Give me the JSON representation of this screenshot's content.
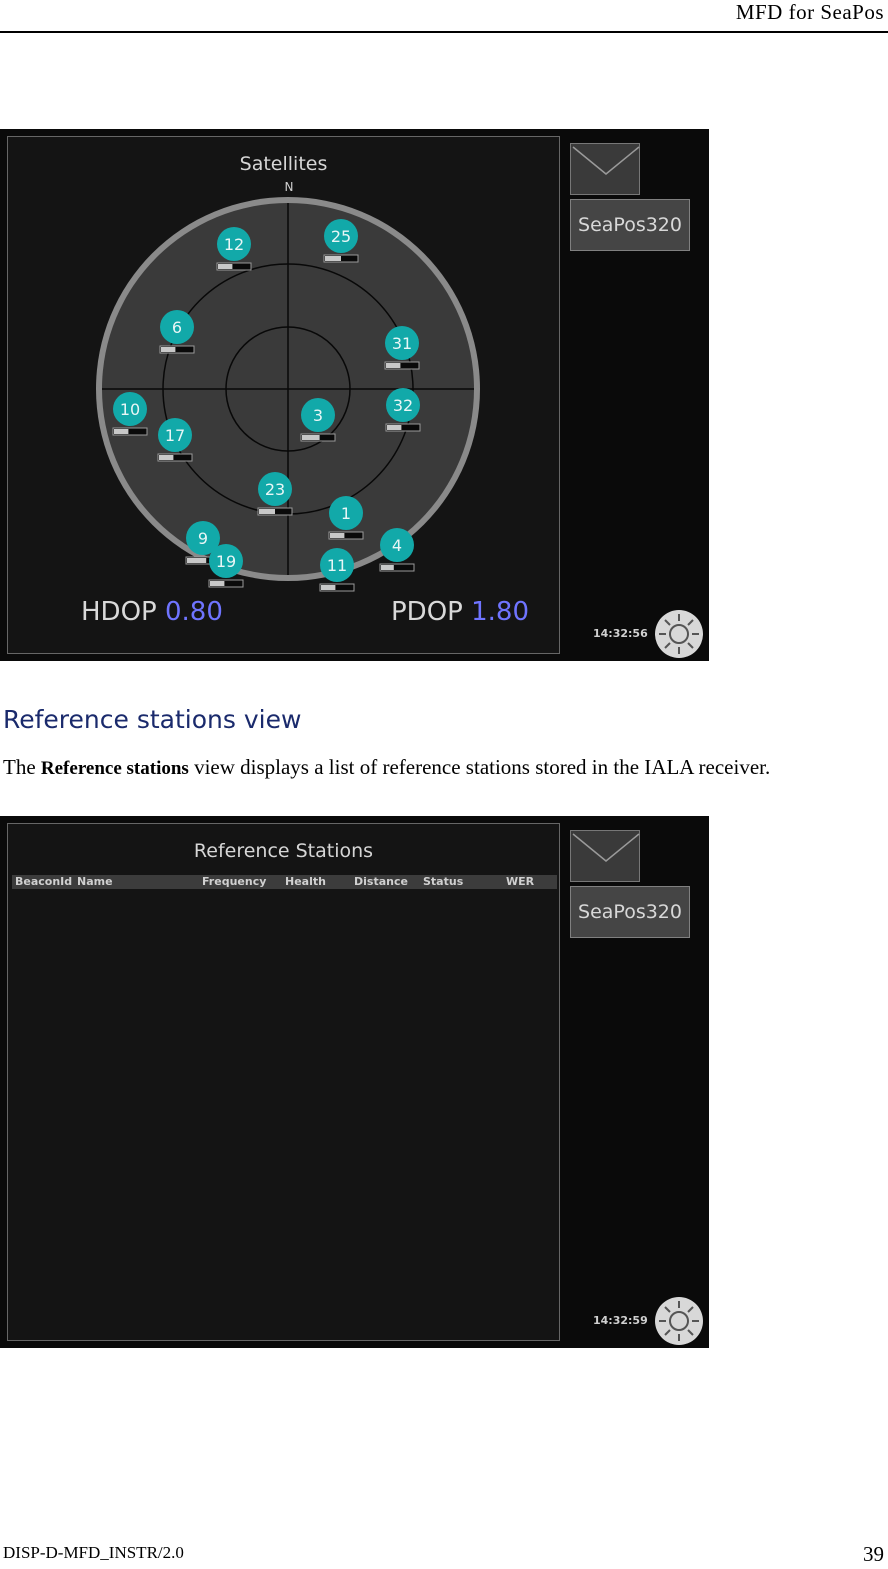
{
  "header": {
    "title": "MFD  for  SeaPos"
  },
  "satellites_screen": {
    "title": "Satellites",
    "north_label": "N",
    "satellites": [
      {
        "id": "12",
        "signal": 0.45
      },
      {
        "id": "25",
        "signal": 0.5
      },
      {
        "id": "6",
        "signal": 0.45
      },
      {
        "id": "31",
        "signal": 0.45
      },
      {
        "id": "10",
        "signal": 0.45
      },
      {
        "id": "17",
        "signal": 0.45
      },
      {
        "id": "3",
        "signal": 0.55
      },
      {
        "id": "32",
        "signal": 0.45
      },
      {
        "id": "23",
        "signal": 0.5
      },
      {
        "id": "1",
        "signal": 0.45
      },
      {
        "id": "4",
        "signal": 0.4
      },
      {
        "id": "9",
        "signal": 0.6
      },
      {
        "id": "19",
        "signal": 0.45
      },
      {
        "id": "11",
        "signal": 0.45
      }
    ],
    "hdop_label": "HDOP",
    "hdop_value": "0.80",
    "pdop_label": "PDOP",
    "pdop_value": "1.80",
    "device_button": "SeaPos320",
    "clock": "14:32:56"
  },
  "section": {
    "heading": "Reference stations view",
    "intro_prefix": "The ",
    "intro_bold": "Reference stations",
    "intro_rest": " view displays a list of reference stations stored in the IALA receiver."
  },
  "reference_screen": {
    "title": "Reference Stations",
    "columns": [
      "BeaconId",
      "Name",
      "Frequency",
      "Health",
      "Distance",
      "Status",
      "WER"
    ],
    "device_button": "SeaPos320",
    "clock": "14:32:59"
  },
  "footer": {
    "doc_id": "DISP-D-MFD_INSTR/2.0",
    "page": "39"
  },
  "colors": {
    "satellite": "#12a9a9",
    "dop_value": "#6f74ff",
    "heading": "#1a2a6c"
  }
}
